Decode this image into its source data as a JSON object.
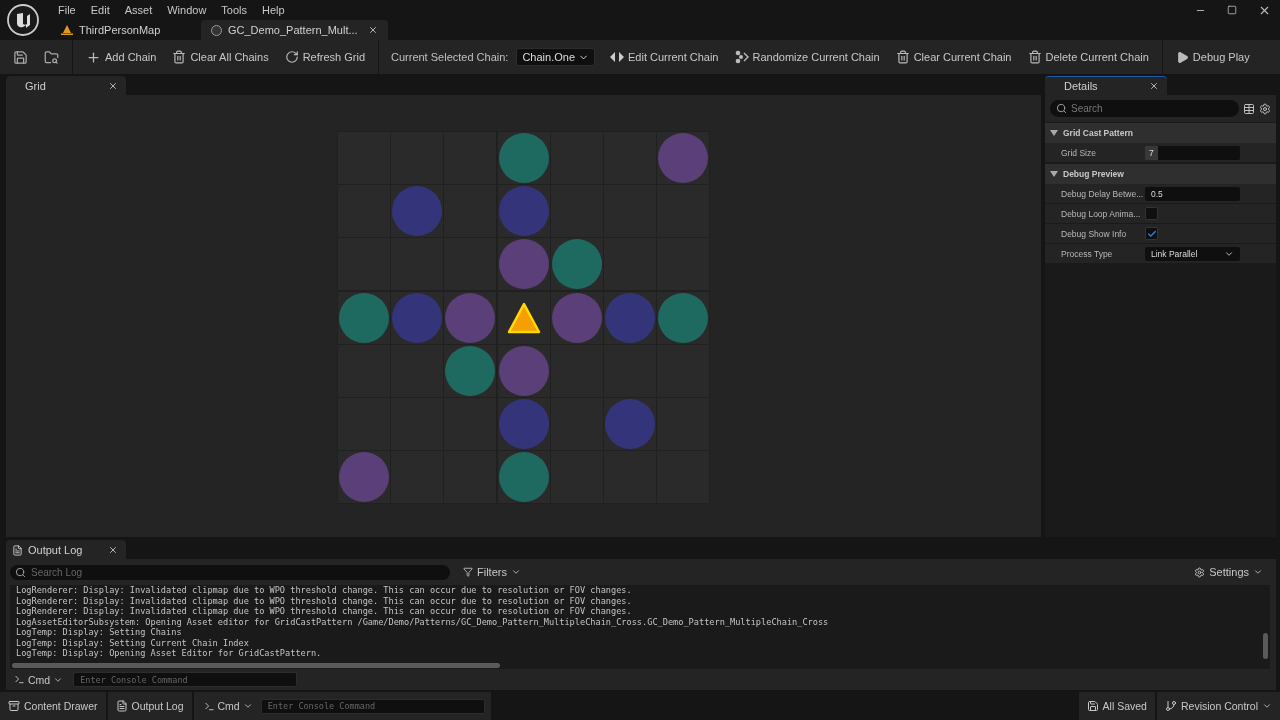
{
  "menu": [
    "File",
    "Edit",
    "Asset",
    "Window",
    "Tools",
    "Help"
  ],
  "document_tabs": [
    {
      "label": "ThirdPersonMap",
      "kind": "map",
      "selected": false
    },
    {
      "label": "GC_Demo_Pattern_Mult...",
      "kind": "asset",
      "selected": true
    }
  ],
  "toolbar": [
    "Add Chain",
    "Clear All Chains",
    "Refresh Grid"
  ],
  "chain_selector": {
    "label": "Current Selected Chain:",
    "value": "Chain.One"
  },
  "chain_actions": [
    "Edit Current Chain",
    "Randomize Current Chain",
    "Clear Current Chain",
    "Delete Current Chain"
  ],
  "debug_play": {
    "label": "Debug Play"
  },
  "grid_panel": {
    "tab": {
      "label": "Grid",
      "selected": false
    },
    "rows": [
      [
        {
          "kind": "empty"
        },
        {
          "kind": "empty"
        },
        {
          "kind": "empty"
        },
        {
          "kind": "dot",
          "color": "#1e6a60"
        },
        {
          "kind": "empty"
        },
        {
          "kind": "empty"
        },
        {
          "kind": "dot",
          "color": "#5a3f78"
        }
      ],
      [
        {
          "kind": "empty"
        },
        {
          "kind": "dot",
          "color": "#34347a"
        },
        {
          "kind": "empty"
        },
        {
          "kind": "dot",
          "color": "#34347a"
        },
        {
          "kind": "empty"
        },
        {
          "kind": "empty"
        },
        {
          "kind": "empty"
        }
      ],
      [
        {
          "kind": "empty"
        },
        {
          "kind": "empty"
        },
        {
          "kind": "empty"
        },
        {
          "kind": "dot",
          "color": "#5a3f78"
        },
        {
          "kind": "dot",
          "color": "#1e6a60"
        },
        {
          "kind": "empty"
        },
        {
          "kind": "empty"
        }
      ],
      [
        {
          "kind": "dot",
          "color": "#1e6a60"
        },
        {
          "kind": "dot",
          "color": "#34347a"
        },
        {
          "kind": "dot",
          "color": "#5a3f78"
        },
        {
          "kind": "origin"
        },
        {
          "kind": "dot",
          "color": "#5a3f78"
        },
        {
          "kind": "dot",
          "color": "#34347a"
        },
        {
          "kind": "dot",
          "color": "#1e6a60"
        }
      ],
      [
        {
          "kind": "empty"
        },
        {
          "kind": "empty"
        },
        {
          "kind": "dot",
          "color": "#1e6a60"
        },
        {
          "kind": "dot",
          "color": "#5a3f78"
        },
        {
          "kind": "empty"
        },
        {
          "kind": "empty"
        },
        {
          "kind": "empty"
        }
      ],
      [
        {
          "kind": "empty"
        },
        {
          "kind": "empty"
        },
        {
          "kind": "empty"
        },
        {
          "kind": "dot",
          "color": "#34347a"
        },
        {
          "kind": "empty"
        },
        {
          "kind": "dot",
          "color": "#34347a"
        },
        {
          "kind": "empty"
        }
      ],
      [
        {
          "kind": "dot",
          "color": "#5a3f78"
        },
        {
          "kind": "empty"
        },
        {
          "kind": "empty"
        },
        {
          "kind": "dot",
          "color": "#1e6a60"
        },
        {
          "kind": "empty"
        },
        {
          "kind": "empty"
        },
        {
          "kind": "empty"
        }
      ]
    ]
  },
  "details": {
    "tab": {
      "label": "Details",
      "selected": true
    },
    "search_placeholder": "Search",
    "sections": [
      {
        "title": "Grid Cast Pattern",
        "expanded": true,
        "rows": [
          {
            "label": "Grid Size",
            "kind": "spin",
            "value": "7"
          }
        ]
      },
      {
        "title": "Debug Preview",
        "expanded": true,
        "rows": [
          {
            "label": "Debug Delay Betwe...",
            "kind": "text",
            "value": "0.5"
          },
          {
            "label": "Debug Loop Anima...",
            "kind": "checkbox",
            "checked": false
          },
          {
            "label": "Debug Show Info",
            "kind": "checkbox",
            "checked": true
          },
          {
            "label": "Process Type",
            "kind": "dropdown",
            "value": "Link Parallel"
          }
        ]
      }
    ]
  },
  "output_log": {
    "tab": {
      "label": "Output Log",
      "selected": false
    },
    "search_placeholder": "Search Log",
    "filters": "Filters",
    "settings": "Settings",
    "lines": [
      "LogRenderer: Display: Invalidated clipmap due to WPO threshold change. This can occur due to resolution or FOV changes.",
      "LogRenderer: Display: Invalidated clipmap due to WPO threshold change. This can occur due to resolution or FOV changes.",
      "LogRenderer: Display: Invalidated clipmap due to WPO threshold change. This can occur due to resolution or FOV changes.",
      "LogAssetEditorSubsystem: Opening Asset editor for GridCastPattern /Game/Demo/Patterns/GC_Demo_Pattern_MultipleChain_Cross.GC_Demo_Pattern_MultipleChain_Cross",
      "LogTemp: Display: Setting Chains",
      "LogTemp: Display: Setting Current Chain Index",
      "LogTemp: Display: Opening Asset Editor for GridCastPattern."
    ],
    "cmd": "Cmd",
    "cmd_placeholder": "Enter Console Command"
  },
  "status_bar": {
    "content_drawer": "Content Drawer",
    "output_log": "Output Log",
    "cmd": "Cmd",
    "cmd_placeholder": "Enter Console Command",
    "saved": "All Saved",
    "revision": "Revision Control"
  }
}
